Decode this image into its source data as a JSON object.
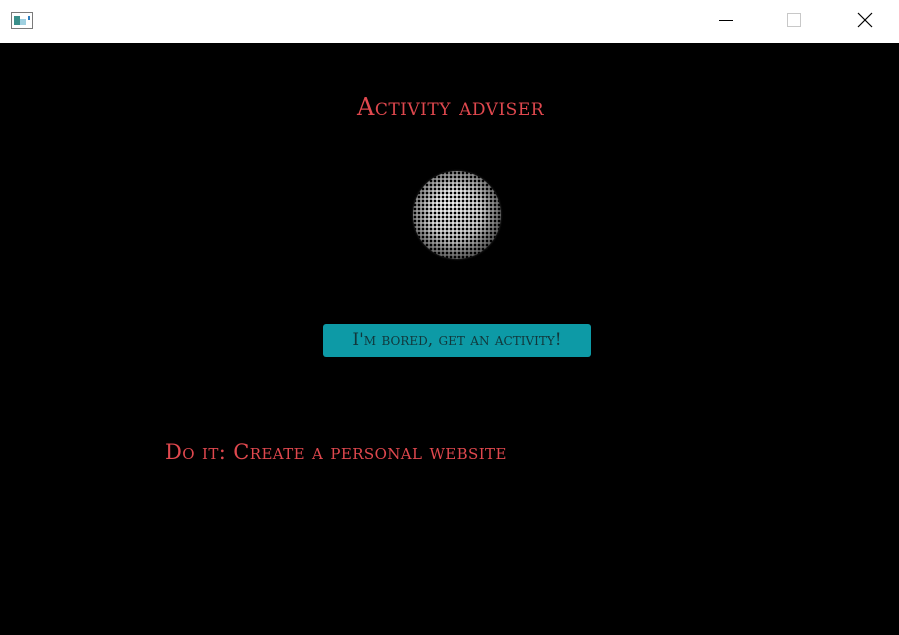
{
  "window": {
    "title": "",
    "controls": {
      "minimize_icon": "minimize-icon",
      "maximize_icon": "maximize-icon",
      "close_icon": "close-icon"
    }
  },
  "app": {
    "title": "Activity adviser",
    "button_label": "I'm bored, get an activity!",
    "result_text": "Do it: Create a personal website"
  },
  "colors": {
    "background": "#000000",
    "title_text": "#e0484e",
    "button_bg": "#0d9aa6",
    "button_text": "#11373b",
    "result_text": "#e0484e"
  }
}
